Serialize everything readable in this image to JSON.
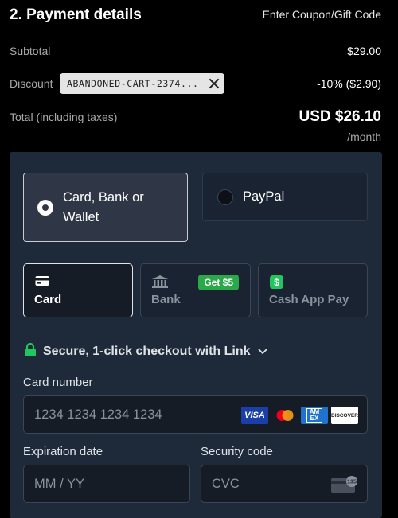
{
  "header": {
    "title": "2. Payment details",
    "coupon_link": "Enter Coupon/Gift Code"
  },
  "summary": {
    "subtotal_label": "Subtotal",
    "subtotal_value": "$29.00",
    "discount_label": "Discount",
    "discount_code": "ABANDONED-CART-2374...",
    "discount_value": "-10% ($2.90)",
    "total_label": "Total (including taxes)",
    "total_value": "USD $26.10",
    "total_period": "/month"
  },
  "payment_methods": {
    "selected": "Card, Bank or Wallet",
    "selected_line1": "Card, Bank or",
    "selected_line2": "Wallet",
    "other": "PayPal"
  },
  "tabs": [
    {
      "label": "Card",
      "icon": "card-icon",
      "selected": true
    },
    {
      "label": "Bank",
      "icon": "bank-icon",
      "badge": "Get $5",
      "selected": false
    },
    {
      "label": "Cash App Pay",
      "icon": "cashapp-icon",
      "selected": false
    }
  ],
  "link": {
    "text": "Secure, 1-click checkout with Link",
    "icon": "lock-icon"
  },
  "form": {
    "card_number_label": "Card number",
    "card_number_placeholder": "1234 1234 1234 1234",
    "expiration_label": "Expiration date",
    "expiration_placeholder": "MM / YY",
    "security_label": "Security code",
    "security_placeholder": "CVC",
    "card_brands": {
      "visa": "VISA",
      "discover": "DISCOVER",
      "amex": "AM EX",
      "cvc_hint": "135"
    }
  },
  "colors": {
    "panel": "#1e2a3a",
    "accent_green": "#2aa84a",
    "link_green": "#22c55e"
  }
}
